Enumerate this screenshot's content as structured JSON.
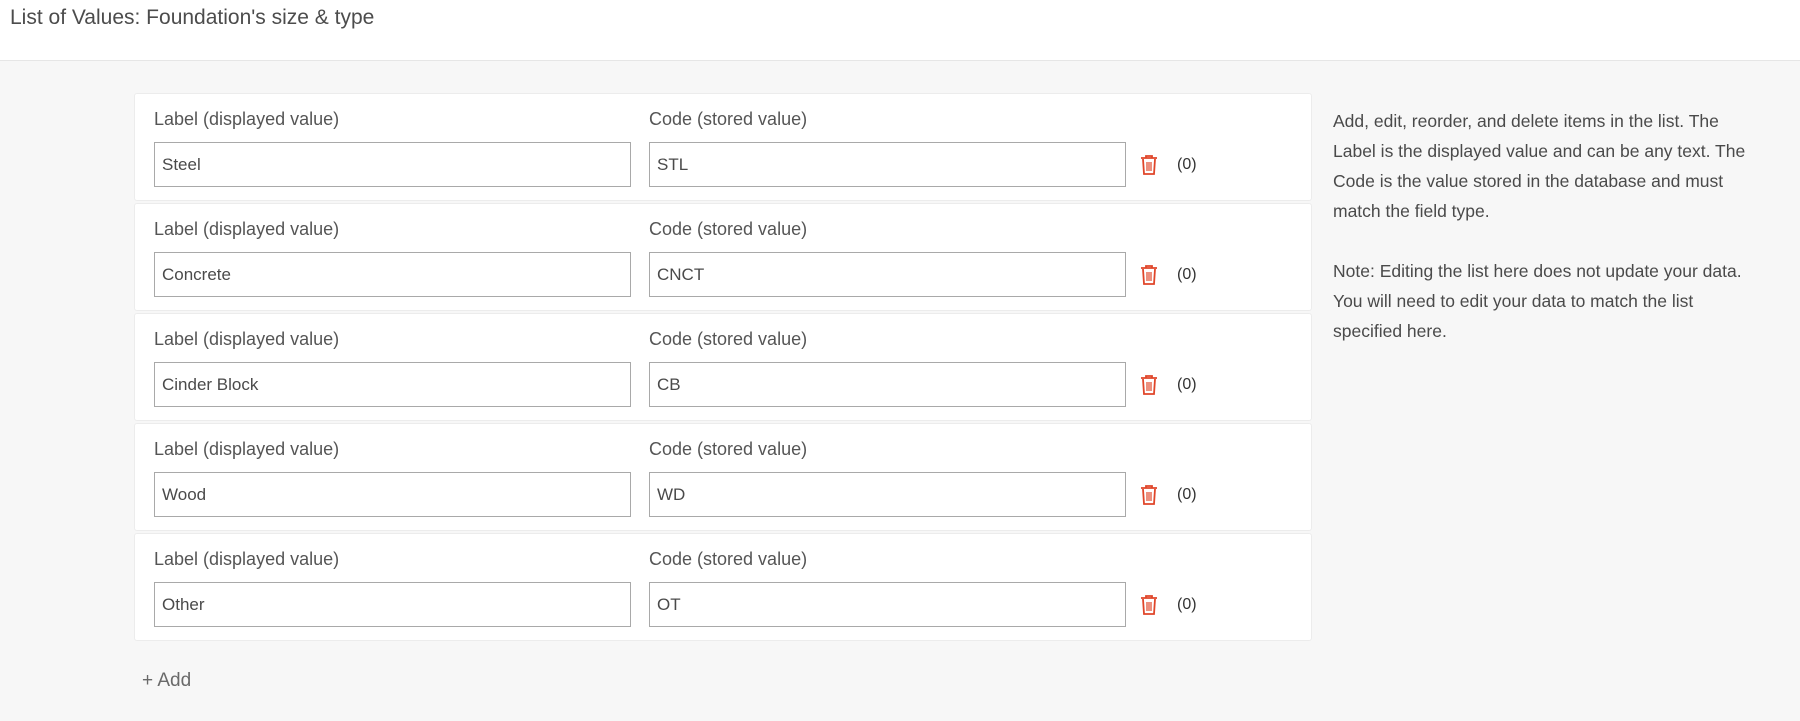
{
  "title": "List of Values: Foundation's size & type",
  "label_header": "Label (displayed value)",
  "code_header": "Code (stored value)",
  "items": [
    {
      "label": "Steel",
      "code": "STL",
      "count": "(0)"
    },
    {
      "label": "Concrete",
      "code": "CNCT",
      "count": "(0)"
    },
    {
      "label": "Cinder Block",
      "code": "CB",
      "count": "(0)"
    },
    {
      "label": "Wood",
      "code": "WD",
      "count": "(0)"
    },
    {
      "label": "Other",
      "code": "OT",
      "count": "(0)"
    }
  ],
  "help": {
    "p1": "Add, edit, reorder, and delete items in the list. The Label is the displayed value and can be any text. The Code is the value stored in the database and must match the field type.",
    "p2": "Note: Editing the list here does not update your data. You will need to edit your data to match the list specified here."
  },
  "add_label": "+ Add",
  "colors": {
    "trash": "#e0462a"
  }
}
